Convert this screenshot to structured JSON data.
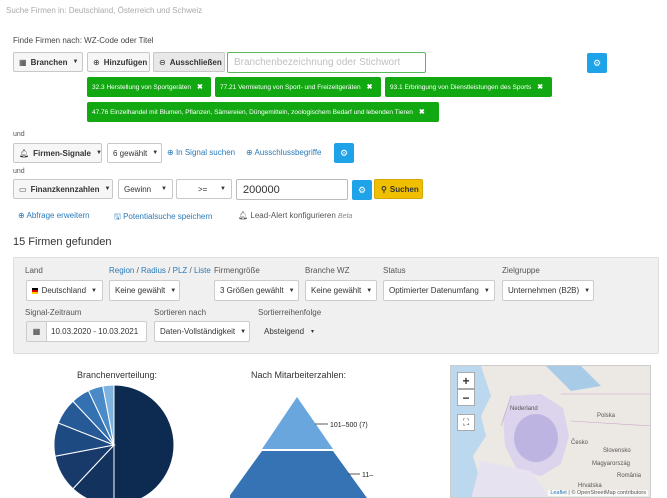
{
  "top_crumb": "Suche Firmen in: Deutschland, Österreich und Schweiz",
  "find_label": "Finde Firmen nach: WZ-Code oder Titel",
  "branchen": {
    "dropdown_label": "Branchen",
    "add_label": "Hinzufügen",
    "exclude_label": "Ausschließen",
    "search_placeholder": "Branchenbezeichnung oder Stichwort",
    "tags": [
      "32.3 Herstellung von Sportgeräten",
      "77.21 Vermietung von Sport- und Freizeitgeräten",
      "93.1 Erbringung von Dienstleistungen des Sports",
      "47.76 Einzelhandel mit Blumen, Pflanzen, Sämereien, Düngemitteln, zoologischem Bedarf und lebenden Tieren"
    ]
  },
  "and_label": "und",
  "signale": {
    "dropdown_label": "Firmen-Signale",
    "count_label": "6 gewählt",
    "in_signal_label": "In Signal suchen",
    "exclude_terms_label": "Ausschlussbegriffe"
  },
  "kennzahlen": {
    "dropdown_label": "Finanzkennzahlen",
    "metric_label": "Gewinn",
    "operator_label": ">=",
    "value": "200000",
    "search_label": "Suchen"
  },
  "actions": {
    "expand_label": "Abfrage erweitern",
    "save_label": "Potentialsuche speichern",
    "alert_label": "Lead-Alert konfigurieren",
    "beta_label": "Beta"
  },
  "results_title": "15 Firmen gefunden",
  "filters": {
    "land_label": "Land",
    "land_value": "Deutschland",
    "region_links": {
      "region": "Region",
      "radius": "Radius",
      "plz": "PLZ",
      "liste": "Liste",
      "sep": " / "
    },
    "region_value": "Keine gewählt",
    "size_label": "Firmengröße",
    "size_value": "3 Größen gewählt",
    "wz_label": "Branche WZ",
    "wz_value": "Keine gewählt",
    "status_label": "Status",
    "status_value": "Optimierter Datenumfang",
    "target_label": "Zielgruppe",
    "target_value": "Unternehmen (B2B)",
    "signal_period_label": "Signal-Zeitraum",
    "signal_period_value": "10.03.2020 - 10.03.2021",
    "sort_label": "Sortieren nach",
    "sort_value": "Daten-Vollständigkeit",
    "order_label": "Sortierreihenfolge",
    "order_value": "Absteigend"
  },
  "pie_title": "Branchenverteilung:",
  "pyramid_title": "Nach Mitarbeiterzahlen:",
  "chart_data": [
    {
      "type": "pie",
      "title": "Branchenverteilung:",
      "categories": [
        "",
        "",
        "",
        "",
        "",
        "",
        "",
        ""
      ],
      "values": [
        50,
        12,
        10,
        9,
        7,
        5,
        4,
        3
      ],
      "colors": [
        "#0d2a50",
        "#13325e",
        "#173a6b",
        "#1e4a82",
        "#255a97",
        "#3471b0",
        "#4a8ac7",
        "#7eb3e0"
      ]
    },
    {
      "type": "bar",
      "title": "Nach Mitarbeiterzahlen:",
      "categories": [
        "101–500 (7)",
        "11–"
      ],
      "values": [
        7,
        8
      ],
      "colors": [
        "#6aa6de",
        "#3573b5"
      ]
    }
  ],
  "map": {
    "zoom_in": "+",
    "zoom_out": "−",
    "fullscreen": "⛶",
    "country_labels": [
      "Nederland",
      "Polska",
      "Česko",
      "Slovensko",
      "Magyarország",
      "România",
      "Hrvatska"
    ],
    "attribution_prefix": "Leaflet",
    "attribution_text": " | © OpenStreetMap contributors"
  },
  "colors": {
    "primary": "#1fa3e8",
    "tag_green": "#12a812",
    "search_yellow": "#f0c000",
    "link": "#2a7ab8"
  }
}
